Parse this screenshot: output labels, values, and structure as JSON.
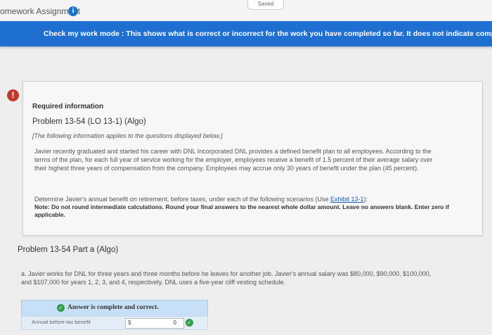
{
  "header": {
    "title": "omework Assignment",
    "saved": "Saved"
  },
  "banner": {
    "text": "Check my work mode : This shows what is correct or incorrect for the work you have completed so far. It does not indicate comp"
  },
  "requirement": {
    "label": "Required information",
    "problem_title": "Problem 13-54 (LO 13-1) (Algo)",
    "note": "[The following information applies to the questions displayed below.]",
    "scenario": "Javier recently graduated and started his career with DNL Incorporated DNL provides a defined benefit plan to all employees. According to the terms of the plan, for each full year of service working for the employer, employees receive a benefit of 1.5 percent of their average salary over their highest three years of compensation from the company. Employees may accrue only 30 years of benefit under the plan (45 percent).",
    "determine_prefix": "Determine Javier's annual benefit on retirement, before taxes, under each of the following scenarios (Use",
    "exhibit_link": "Exhibit 13-1",
    "determine_suffix": "):",
    "round_note": "Note: Do not round intermediate calculations. Round your final answers to the nearest whole dollar amount. Leave no answers blank. Enter zero if applicable."
  },
  "part_a": {
    "title": "Problem 13-54 Part a (Algo)",
    "description": "a. Javier works for DNL for three years and three months before he leaves for another job. Javier's annual salary was $80,000, $90,000, $100,000, and $107,000 for years 1, 2, 3, and 4, respectively. DNL uses a five-year cliff vesting schedule.",
    "answer_status": "Answer is complete and correct.",
    "row_label": "Annual before-tax benefit",
    "currency": "$",
    "amount": "0"
  },
  "colors": {
    "banner": "#1f6fd0",
    "alert": "#c0392b",
    "correct": "#2e9e4a"
  }
}
